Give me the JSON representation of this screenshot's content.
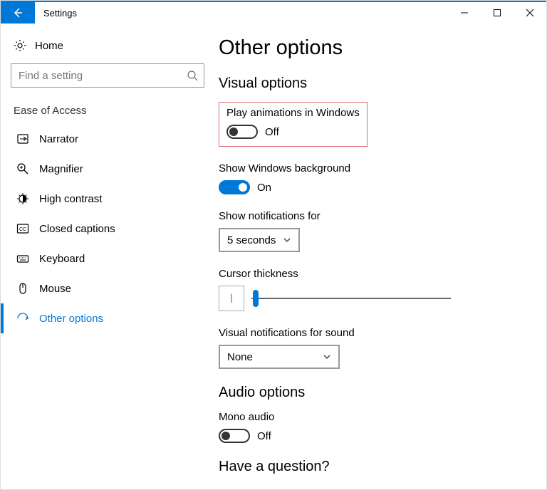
{
  "window": {
    "title": "Settings"
  },
  "sidebar": {
    "home_label": "Home",
    "search_placeholder": "Find a setting",
    "category": "Ease of Access",
    "items": [
      {
        "label": "Narrator",
        "icon": "narrator"
      },
      {
        "label": "Magnifier",
        "icon": "magnifier"
      },
      {
        "label": "High contrast",
        "icon": "contrast"
      },
      {
        "label": "Closed captions",
        "icon": "cc"
      },
      {
        "label": "Keyboard",
        "icon": "keyboard"
      },
      {
        "label": "Mouse",
        "icon": "mouse"
      },
      {
        "label": "Other options",
        "icon": "other"
      }
    ],
    "active_index": 6
  },
  "page": {
    "heading": "Other options",
    "visual_section": "Visual options",
    "audio_section": "Audio options",
    "question_section": "Have a question?",
    "play_anim": {
      "label": "Play animations in Windows",
      "on": false,
      "state": "Off"
    },
    "show_bg": {
      "label": "Show Windows background",
      "on": true,
      "state": "On"
    },
    "notifications": {
      "label": "Show notifications for",
      "value": "5 seconds"
    },
    "cursor": {
      "label": "Cursor thickness",
      "preview": "|",
      "value_pct": 2,
      "min": 1,
      "max": 20
    },
    "visual_notif": {
      "label": "Visual notifications for sound",
      "value": "None"
    },
    "mono_audio": {
      "label": "Mono audio",
      "on": false,
      "state": "Off"
    }
  }
}
